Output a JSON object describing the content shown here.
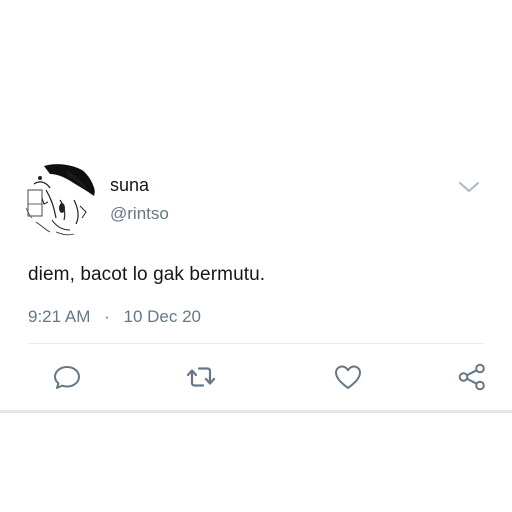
{
  "tweet": {
    "display_name": "suna",
    "handle": "@rintso",
    "text": "diem, bacot lo gak bermutu.",
    "time": "9:21 AM",
    "separator": "·",
    "date": "10 Dec 20"
  },
  "icons": {
    "caret": "chevron-down-icon",
    "reply": "reply-icon",
    "retweet": "retweet-icon",
    "like": "heart-icon",
    "share": "share-icon"
  },
  "colors": {
    "text": "#14171a",
    "secondary": "#657786",
    "divider": "#e6ecf0",
    "icon": "#657786"
  }
}
